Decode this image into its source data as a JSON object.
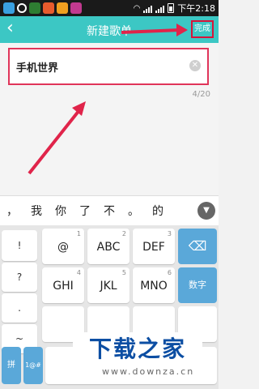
{
  "status_bar": {
    "time": "下午2:18"
  },
  "header": {
    "back_glyph": "‹",
    "title": "新建歌单",
    "done_label": "完成"
  },
  "editor": {
    "input_value": "手机世界",
    "counter": "4/20",
    "clear_glyph": "✕"
  },
  "candidates": {
    "items": [
      "，",
      "我",
      "你",
      "了",
      "不",
      "。",
      "的"
    ]
  },
  "keyboard": {
    "symbols": [
      "!",
      "?",
      ".",
      "~"
    ],
    "keys": [
      {
        "label": "@",
        "num": "1"
      },
      {
        "label": "ABC",
        "num": "2"
      },
      {
        "label": "DEF",
        "num": "3"
      },
      {
        "label": "GHI",
        "num": "4"
      },
      {
        "label": "JKL",
        "num": "5"
      },
      {
        "label": "MNO",
        "num": "6"
      }
    ],
    "delete_glyph": "⌫",
    "numbers_label": "数字",
    "pinyin_label": "拼",
    "mode_label": "1@#"
  },
  "watermark": {
    "text": "下载之家",
    "url": "www.downza.cn"
  },
  "colors": {
    "accent": "#3cc7c4",
    "highlight": "#e0355a",
    "key_blue": "#5aa8d9"
  }
}
